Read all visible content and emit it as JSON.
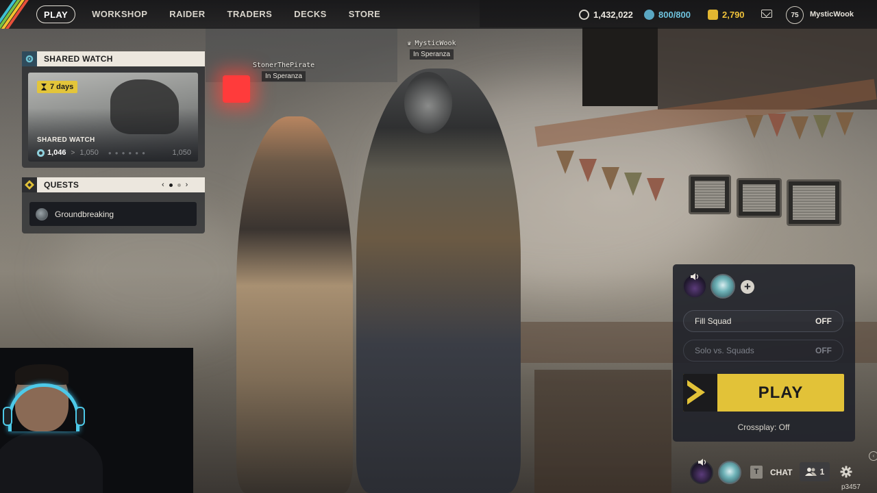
{
  "nav": {
    "items": [
      {
        "label": "PLAY",
        "active": true
      },
      {
        "label": "WORKSHOP",
        "active": false
      },
      {
        "label": "RAIDER",
        "active": false
      },
      {
        "label": "TRADERS",
        "active": false
      },
      {
        "label": "DECKS",
        "active": false
      },
      {
        "label": "STORE",
        "active": false
      }
    ],
    "currencies": {
      "credits": "1,432,022",
      "energy": "800/800",
      "tokens": "2,790"
    },
    "level": "75",
    "username": "MysticWook"
  },
  "shared_watch": {
    "header": "SHARED WATCH",
    "time_left": "7 days",
    "card_title": "SHARED WATCH",
    "progress_current": "1,046",
    "progress_next": "1,050",
    "progress_goal": "1,050"
  },
  "quests": {
    "header": "QUESTS",
    "items": [
      {
        "label": "Groundbreaking"
      }
    ]
  },
  "player_tags": [
    {
      "name": "MysticWook",
      "location": "In Speranza"
    },
    {
      "name": "StonerThePirate",
      "location": "In Speranza"
    }
  ],
  "squad": {
    "fill_squad_label": "Fill Squad",
    "fill_squad_value": "OFF",
    "solo_vs_squads_label": "Solo vs. Squads",
    "solo_vs_squads_value": "OFF",
    "play_label": "PLAY",
    "crossplay": "Crossplay: Off"
  },
  "bottom_bar": {
    "chat_key": "T",
    "chat_label": "CHAT",
    "friends_count": "1",
    "build": "p3457"
  },
  "colors": {
    "accent_yellow": "#e2c238",
    "header_bg": "#ece7de",
    "panel_bg": "#20222a"
  }
}
